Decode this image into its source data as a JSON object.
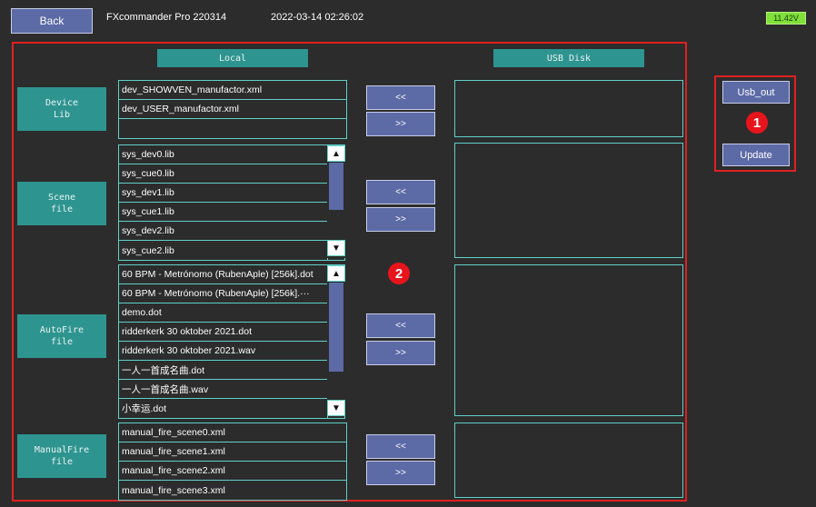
{
  "header": {
    "back_label": "Back",
    "app_title": "FXcommander Pro 220314",
    "datetime": "2022-03-14 02:26:02",
    "battery": "11.42V"
  },
  "columns": {
    "local": "Local",
    "usb": "USB Disk"
  },
  "categories": {
    "device_lib": {
      "label": "Device\nLib",
      "files": [
        "dev_SHOWVEN_manufactor.xml",
        "dev_USER_manufactor.xml",
        ""
      ]
    },
    "scene_file": {
      "label": "Scene\nfile",
      "files": [
        "sys_dev0.lib",
        "sys_cue0.lib",
        "sys_dev1.lib",
        "sys_cue1.lib",
        "sys_dev2.lib",
        "sys_cue2.lib"
      ]
    },
    "autofire_file": {
      "label": "AutoFire\nfile",
      "files": [
        "60 BPM - Metrónomo (RubenAple) [256k].dot",
        "60 BPM - Metrónomo (RubenAple) [256k].···",
        "demo.dot",
        "ridderkerk 30 oktober 2021.dot",
        "ridderkerk 30 oktober 2021.wav",
        "一人一首成名曲.dot",
        "一人一首成名曲.wav",
        "小幸运.dot"
      ]
    },
    "manualfire_file": {
      "label": "ManualFire\nfile",
      "files": [
        "manual_fire_scene0.xml",
        "manual_fire_scene1.xml",
        "manual_fire_scene2.xml",
        "manual_fire_scene3.xml"
      ]
    }
  },
  "transfer": {
    "to_local": "<<",
    "to_usb": ">>"
  },
  "side": {
    "usb_out": "Usb_out",
    "update": "Update"
  },
  "markers": {
    "one": "1",
    "two": "2"
  },
  "icons": {
    "scroll_up": "triangle-up-icon",
    "scroll_down": "triangle-down-icon"
  },
  "colors": {
    "accent_teal": "#2e9490",
    "button_blue": "#5c6aa6",
    "list_border": "#5fd0c8",
    "highlight_red": "#e02020",
    "battery_green": "#7fe03a"
  }
}
